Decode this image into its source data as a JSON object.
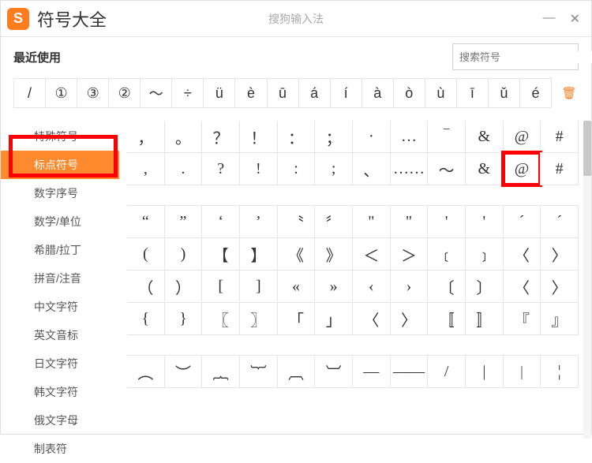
{
  "titlebar": {
    "logo": "S",
    "title": "符号大全",
    "subtitle": "搜狗输入法"
  },
  "recent": {
    "label": "最近使用",
    "search_placeholder": "搜索符号",
    "items": [
      "/",
      "①",
      "③",
      "②",
      "～",
      "÷",
      "ü",
      "è",
      "ū",
      "á",
      "í",
      "à",
      "ò",
      "ù",
      "ī",
      "ǔ",
      "é"
    ]
  },
  "sidebar": {
    "items": [
      "特殊符号",
      "标点符号",
      "数字序号",
      "数学/单位",
      "希腊/拉丁",
      "拼音/注音",
      "中文字符",
      "英文音标",
      "日文字符",
      "韩文字符",
      "俄文字母",
      "制表符"
    ],
    "active_index": 1
  },
  "blocks": [
    {
      "rows": [
        [
          "，",
          "。",
          "？",
          "！",
          "：",
          "；",
          "·",
          "…",
          "‾",
          "&",
          "@",
          "#"
        ],
        [
          ",",
          ".",
          "?",
          "!",
          ":",
          ";",
          "、",
          "……",
          "～",
          "&",
          "@",
          "#"
        ]
      ],
      "highlight": {
        "row": 1,
        "col": 10
      }
    },
    {
      "rows": [
        [
          "“",
          "”",
          "‘",
          "’",
          "〝",
          "〞",
          "\"",
          "\"",
          "'",
          "'",
          "´",
          "ˊ"
        ],
        [
          "(",
          ")",
          "【",
          "】",
          "《",
          "》",
          "＜",
          "＞",
          "﹝",
          "﹞",
          "〈",
          "〉"
        ],
        [
          "（",
          "）",
          "[",
          "]",
          "«",
          "»",
          "‹",
          "›",
          "〔",
          "〕",
          "〈",
          "〉"
        ],
        [
          "{",
          "}",
          "〖",
          "〗",
          "「",
          "」",
          "〈",
          "〉",
          "〚",
          "〛",
          "『",
          "』"
        ]
      ]
    },
    {
      "rows": [
        [
          "︵",
          "︶",
          "︷",
          "︸",
          "︹",
          "︺",
          "—",
          "——",
          "/",
          "|",
          "︱",
          "¦"
        ]
      ]
    }
  ]
}
